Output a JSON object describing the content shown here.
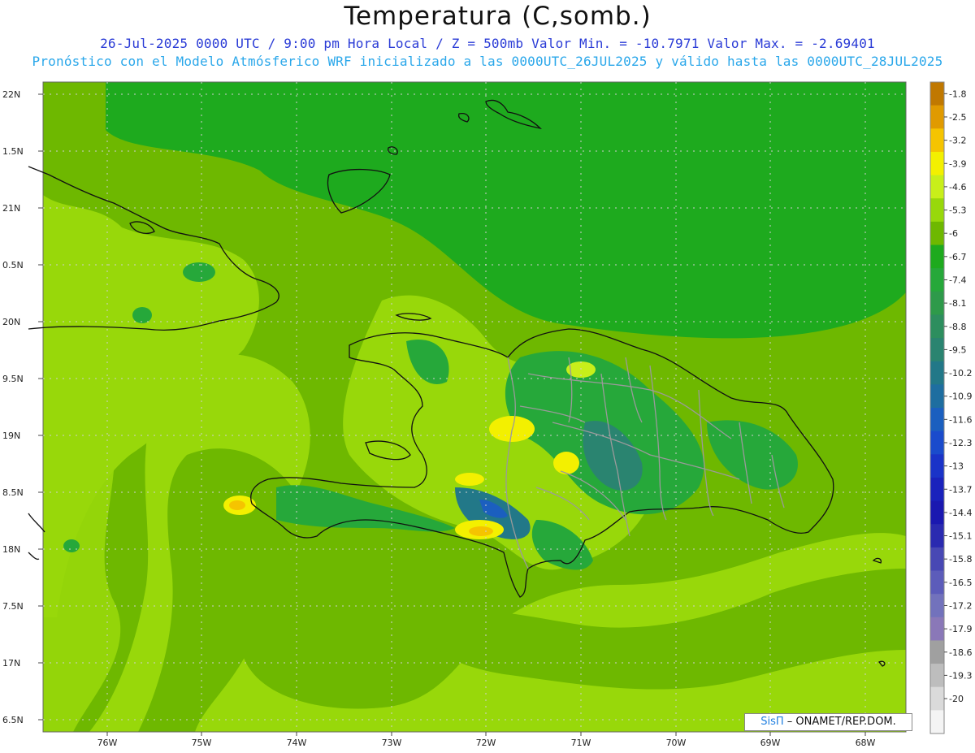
{
  "header": {
    "title": "Temperatura (C,somb.)",
    "line1": "26-Jul-2025  0000 UTC / 9:00 pm Hora Local / Z = 500mb  Valor Min. = -10.7971  Valor Max. = -2.69401",
    "line2": "Pronóstico con el Modelo Atmósferico WRF inicializado a las 0000UTC_26JUL2025 y válido hasta las  0000UTC_28JUL2025"
  },
  "axes": {
    "lat_labels": [
      "22N",
      "1.5N",
      "21N",
      "0.5N",
      "20N",
      "9.5N",
      "19N",
      "8.5N",
      "18N",
      "7.5N",
      "17N",
      "6.5N"
    ],
    "lon_labels": [
      "76W",
      "75W",
      "74W",
      "73W",
      "72W",
      "71W",
      "70W",
      "69W",
      "68W"
    ]
  },
  "colorbar": {
    "levels": [
      "-1.8",
      "-2.5",
      "-3.2",
      "-3.9",
      "-4.6",
      "-5.3",
      "-6",
      "-6.7",
      "-7.4",
      "-8.1",
      "-8.8",
      "-9.5",
      "-10.2",
      "-10.9",
      "-11.6",
      "-12.3",
      "-13",
      "-13.7",
      "-14.4",
      "-15.1",
      "-15.8",
      "-16.5",
      "-17.2",
      "-17.9",
      "-18.6",
      "-19.3",
      "-20"
    ],
    "colors": [
      "#c07800",
      "#e09a00",
      "#f5c400",
      "#f3f000",
      "#c8ef1a",
      "#98d80a",
      "#6eb800",
      "#1eaa1e",
      "#26a83a",
      "#2e9a4a",
      "#2d8e5e",
      "#2a8470",
      "#227888",
      "#1e6ea0",
      "#1b5fbf",
      "#1a4bcc",
      "#1a33c8",
      "#1a22bc",
      "#1a18b0",
      "#2a2ab0",
      "#4848b4",
      "#5c5cba",
      "#7272bc",
      "#8a78b8",
      "#a0a0a0",
      "#bdbdbd",
      "#dadada",
      "#f4f4f4"
    ]
  },
  "credit": {
    "brand": "SisΠ",
    "org": " – ONAMET/REP.DOM."
  },
  "field": {
    "min": -10.7971,
    "max": -2.69401,
    "units": "C"
  }
}
